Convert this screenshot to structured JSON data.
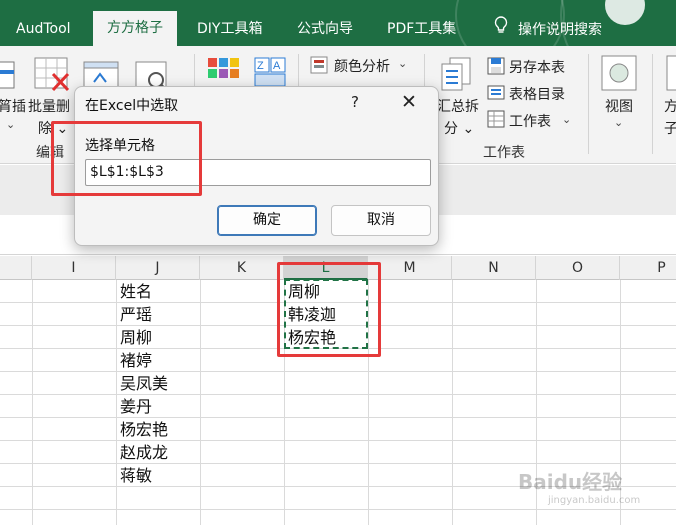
{
  "tabs": [
    {
      "label": "AudTool"
    },
    {
      "label": "方方格子"
    },
    {
      "label": "DIY工具箱"
    },
    {
      "label": "公式向导"
    },
    {
      "label": "PDF工具集"
    },
    {
      "label": "操作说明搜索"
    }
  ],
  "ribbon": {
    "edit_left_top": "筲插",
    "edit_left_bottom": "⌄",
    "batch_delete_top": "批量删",
    "batch_delete_bottom": "除 ⌄",
    "edit_group": "编辑",
    "color_analysis": "颜色分析",
    "color_analysis_arrow": "⌄",
    "summary_split_top": "汇总拆",
    "summary_split_bottom": "分 ⌄",
    "save_as": "另存本表",
    "table_toc": "表格目录",
    "worksheet": "工作表",
    "worksheet_arrow": "⌄",
    "worksheet_group": "工作表",
    "view": "视图",
    "view_arrow": "⌄",
    "right_cut_top": "方",
    "right_cut_bottom": "子"
  },
  "columns": [
    "I",
    "J",
    "K",
    "L",
    "M",
    "N",
    "O",
    "P"
  ],
  "column_j": [
    "姓名",
    "严瑶",
    "周柳",
    "褚婷",
    "吴凤美",
    "姜丹",
    "杨宏艳",
    "赵成龙",
    "蒋敏"
  ],
  "column_l": [
    "周柳",
    "韩凌迦",
    "杨宏艳"
  ],
  "dialog": {
    "title": "在Excel中选取",
    "help": "?",
    "close": "✕",
    "label": "选择单元格",
    "value": "$L$1:$L$3",
    "ok": "确定",
    "cancel": "取消"
  },
  "watermark": {
    "brand": "Baidu经验",
    "url": "jingyan.baidu.com"
  },
  "colors": {
    "excel_green": "#1e6e43",
    "highlight_red": "#e53a3a",
    "marching_ants": "#217346"
  }
}
